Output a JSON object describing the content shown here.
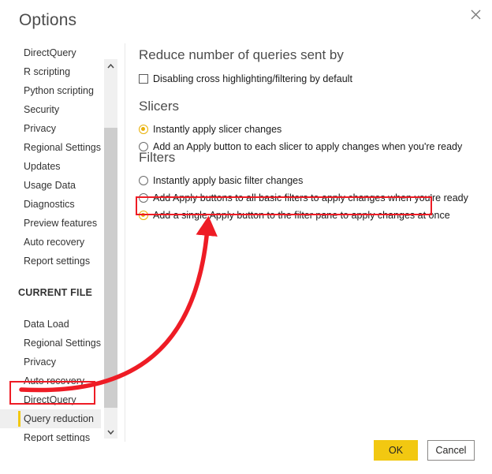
{
  "dialog": {
    "title": "Options",
    "close_icon": "close-icon"
  },
  "sidebar": {
    "global_items": [
      {
        "label": "DirectQuery",
        "selected": false
      },
      {
        "label": "R scripting",
        "selected": false
      },
      {
        "label": "Python scripting",
        "selected": false
      },
      {
        "label": "Security",
        "selected": false
      },
      {
        "label": "Privacy",
        "selected": false
      },
      {
        "label": "Regional Settings",
        "selected": false
      },
      {
        "label": "Updates",
        "selected": false
      },
      {
        "label": "Usage Data",
        "selected": false
      },
      {
        "label": "Diagnostics",
        "selected": false
      },
      {
        "label": "Preview features",
        "selected": false
      },
      {
        "label": "Auto recovery",
        "selected": false
      },
      {
        "label": "Report settings",
        "selected": false
      }
    ],
    "group_header": "CURRENT FILE",
    "current_file_items": [
      {
        "label": "Data Load",
        "selected": false
      },
      {
        "label": "Regional Settings",
        "selected": false
      },
      {
        "label": "Privacy",
        "selected": false
      },
      {
        "label": "Auto recovery",
        "selected": false
      },
      {
        "label": "DirectQuery",
        "selected": false
      },
      {
        "label": "Query reduction",
        "selected": true
      },
      {
        "label": "Report settings",
        "selected": false
      }
    ],
    "scrollbar": {
      "up_icon": "chevron-up-icon",
      "down_icon": "chevron-down-icon"
    }
  },
  "content": {
    "heading_reduce": "Reduce number of queries sent by",
    "checkbox_disable_cross": {
      "label": "Disabling cross highlighting/filtering by default",
      "checked": false
    },
    "heading_slicers": "Slicers",
    "slicer_options": [
      {
        "label": "Instantly apply slicer changes",
        "checked": true
      },
      {
        "label": "Add an Apply button to each slicer to apply changes when you're ready",
        "checked": false
      }
    ],
    "heading_filters": "Filters",
    "filter_options": [
      {
        "label": "Instantly apply basic filter changes",
        "checked": false
      },
      {
        "label": "Add Apply buttons to all basic filters to apply changes when you're ready",
        "checked": false
      },
      {
        "label": "Add a single Apply button to the filter pane to apply changes at once",
        "checked": true
      }
    ]
  },
  "footer": {
    "ok_label": "OK",
    "cancel_label": "Cancel"
  },
  "annotations": {
    "color": "#ee1c25",
    "highlight_option": "Add a single Apply button to the filter pane to apply changes at once",
    "highlight_nav_item": "Query reduction",
    "arrow": "curved-arrow-pointing-from-query-reduction-to-filter-option"
  },
  "colors": {
    "accent": "#f2c811",
    "radio_selected": "#e8b007",
    "annotation_red": "#ee1c25",
    "text": "#1a1a1a",
    "heading": "#4c4c4c"
  }
}
